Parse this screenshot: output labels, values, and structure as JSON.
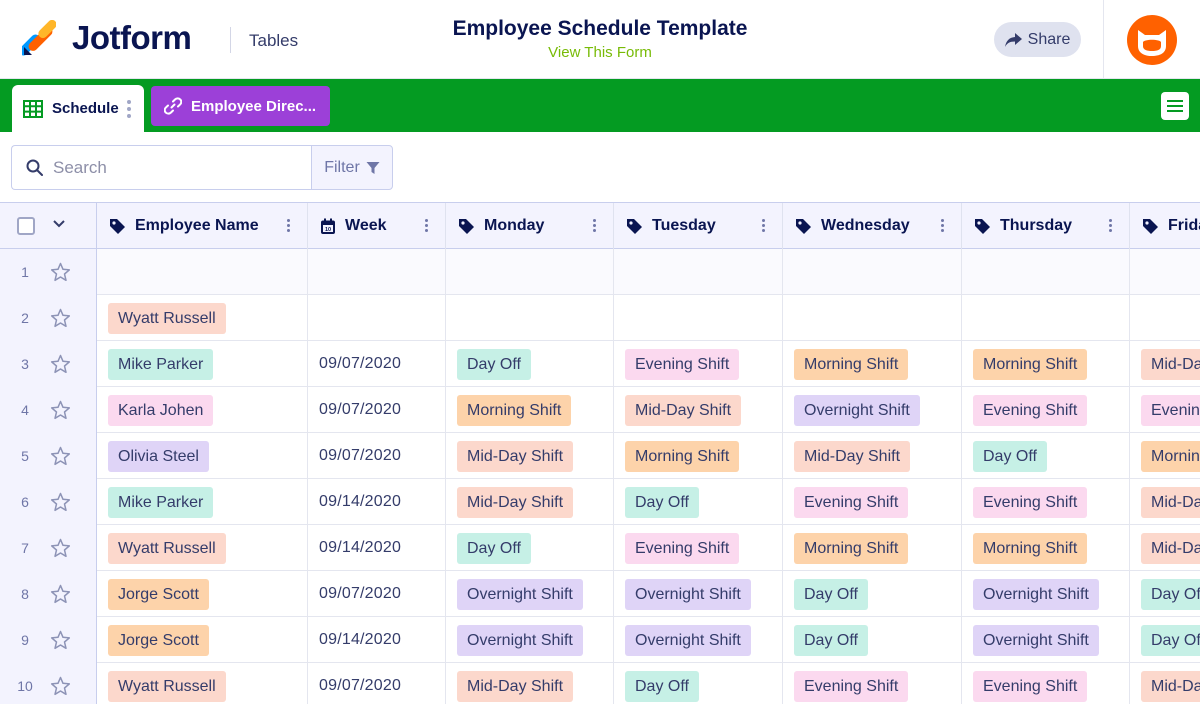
{
  "header": {
    "logo_text": "Jotform",
    "product": "Tables",
    "form_title": "Employee Schedule Template",
    "view_form": "View This Form",
    "share_label": "Share"
  },
  "tabs": [
    {
      "label": "Schedule",
      "icon": "table-grid-icon"
    },
    {
      "label": "Employee Direc...",
      "icon": "link-icon"
    }
  ],
  "toolbar": {
    "search_placeholder": "Search",
    "filter_label": "Filter"
  },
  "columns": [
    "Employee Name",
    "Week",
    "Monday",
    "Tuesday",
    "Wednesday",
    "Thursday",
    "Friday"
  ],
  "rows": [
    {
      "num": "1",
      "name": "",
      "week": "",
      "mon": "",
      "tue": "",
      "wed": "",
      "thu": "",
      "fri": ""
    },
    {
      "num": "2",
      "name": "Wyatt Russell",
      "week": "",
      "mon": "",
      "tue": "",
      "wed": "",
      "thu": "",
      "fri": ""
    },
    {
      "num": "3",
      "name": "Mike Parker",
      "week": "09/07/2020",
      "mon": "Day Off",
      "tue": "Evening Shift",
      "wed": "Morning Shift",
      "thu": "Morning Shift",
      "fri": "Mid-Day Shift"
    },
    {
      "num": "4",
      "name": "Karla Johen",
      "week": "09/07/2020",
      "mon": "Morning Shift",
      "tue": "Mid-Day Shift",
      "wed": "Overnight Shift",
      "thu": "Evening Shift",
      "fri": "Evening Shift"
    },
    {
      "num": "5",
      "name": "Olivia Steel",
      "week": "09/07/2020",
      "mon": "Mid-Day Shift",
      "tue": "Morning Shift",
      "wed": "Mid-Day Shift",
      "thu": "Day Off",
      "fri": "Morning Shift"
    },
    {
      "num": "6",
      "name": "Mike Parker",
      "week": "09/14/2020",
      "mon": "Mid-Day Shift",
      "tue": "Day Off",
      "wed": "Evening Shift",
      "thu": "Evening Shift",
      "fri": "Mid-Day Shift"
    },
    {
      "num": "7",
      "name": "Wyatt Russell",
      "week": "09/14/2020",
      "mon": "Day Off",
      "tue": "Evening Shift",
      "wed": "Morning Shift",
      "thu": "Morning Shift",
      "fri": "Mid-Day Shift"
    },
    {
      "num": "8",
      "name": "Jorge Scott",
      "week": "09/07/2020",
      "mon": "Overnight Shift",
      "tue": "Overnight Shift",
      "wed": "Day Off",
      "thu": "Overnight Shift",
      "fri": "Day Off"
    },
    {
      "num": "9",
      "name": "Jorge Scott",
      "week": "09/14/2020",
      "mon": "Overnight Shift",
      "tue": "Overnight Shift",
      "wed": "Day Off",
      "thu": "Overnight Shift",
      "fri": "Day Off"
    },
    {
      "num": "10",
      "name": "Wyatt Russell",
      "week": "09/07/2020",
      "mon": "Mid-Day Shift",
      "tue": "Day Off",
      "wed": "Evening Shift",
      "thu": "Evening Shift",
      "fri": "Mid-Day Shift"
    }
  ],
  "name_colors": {
    "Wyatt Russell": "#fcd8cc",
    "Mike Parker": "#c6f0e6",
    "Karla Johen": "#fbd9ef",
    "Olivia Steel": "#dfd4f7",
    "Jorge Scott": "#fdd3aa"
  },
  "shift_colors": {
    "Day Off": "#c6f0e6",
    "Evening Shift": "#fbd9ef",
    "Morning Shift": "#fdd3aa",
    "Mid-Day Shift": "#fcd8cc",
    "Overnight Shift": "#dfd4f7"
  },
  "colors": {
    "tabbar": "#049b22",
    "link_tab": "#9c40d8",
    "view_form_link": "#78bb07",
    "avatar": "#ff6100"
  }
}
